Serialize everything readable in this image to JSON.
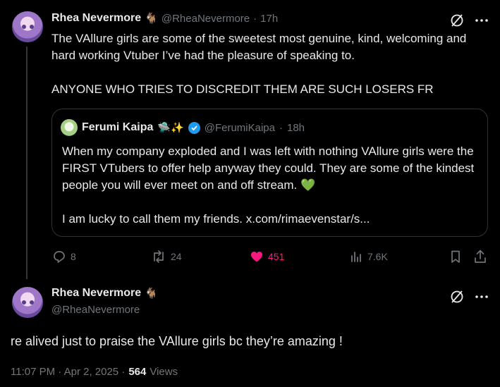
{
  "main_post": {
    "author_name": "Rhea Nevermore",
    "author_emoji": "🐐",
    "handle": "@RheaNevermore",
    "separator": "·",
    "time": "17h",
    "text": "The VAllure girls are some of the sweetest most genuine, kind, welcoming and hard working Vtuber I’ve had the pleasure of speaking to.\n\nANYONE WHO TRIES TO DISCREDIT THEM ARE SUCH LOSERS FR",
    "quote": {
      "author_name": "Ferumi Kaipa",
      "author_emojis": "🛸✨",
      "handle": "@FerumiKaipa",
      "separator": "·",
      "time": "18h",
      "text": "When my company exploded and I was left with nothing VAllure girls were the FIRST VTubers to offer help anyway they could. They are some of the kindest people you will ever meet on and off stream. 💚\n\nI am lucky to call them my friends. x.com/rimaevenstar/s..."
    },
    "actions": {
      "replies": "8",
      "reposts": "24",
      "likes": "451",
      "views": "7.6K"
    }
  },
  "reply_post": {
    "author_name": "Rhea Nevermore",
    "author_emoji": "🐐",
    "handle": "@RheaNevermore",
    "text": "re alived just to praise the VAllure girls bc they’re amazing !",
    "timestamp": "11:07 PM · Apr 2, 2025 ·",
    "views_count": "564",
    "views_label": "Views"
  },
  "colors": {
    "background": "#000000",
    "text": "#e7e9ea",
    "muted": "#71767b",
    "like_pink": "#f91880",
    "verified_blue": "#1d9bf0",
    "border": "#2f3336"
  }
}
